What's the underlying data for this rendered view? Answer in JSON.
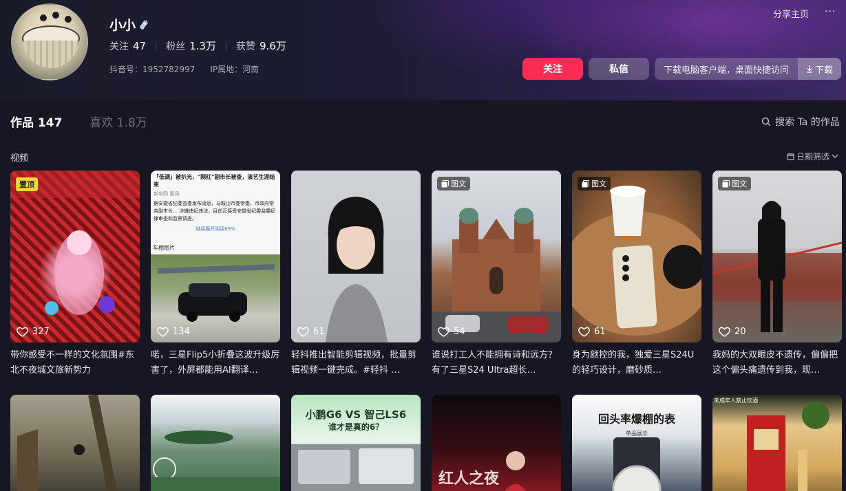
{
  "profile": {
    "name": "小小",
    "following_label": "关注",
    "following_count": "47",
    "followers_label": "粉丝",
    "followers_count": "1.3万",
    "likes_label": "获赞",
    "likes_count": "9.6万",
    "douyin_id": "抖音号：1952782997",
    "ip_location": "IP属地：河南"
  },
  "header": {
    "share_label": "分享主页",
    "more_label": "···",
    "follow_button": "关注",
    "message_button": "私信",
    "download_text": "下载电脑客户端，桌面快捷访问",
    "download_button": "下载"
  },
  "tabs": {
    "works": "作品 147",
    "likes": "喜欢 1.8万",
    "search": "搜索 Ta 的作品"
  },
  "section": {
    "label": "视频",
    "date_filter": "日期筛选"
  },
  "badges": {
    "pinned": "置顶",
    "image_post": "图文"
  },
  "videos_row1": [
    {
      "likes": "327",
      "caption": "带你感受不一样的文化氛围#东北不夜城文旅新势力",
      "pinned": true,
      "type": ""
    },
    {
      "likes": "134",
      "caption": "喏，三星Flip5小折叠这波升级厉害了，外屏都能用AI翻译…",
      "pinned": false,
      "type": ""
    },
    {
      "likes": "61",
      "caption": "轻抖推出智能剪辑视频，批量剪辑视频一键完成。#轻抖 …",
      "pinned": false,
      "type": ""
    },
    {
      "likes": "54",
      "caption": "谁说打工人不能拥有诗和远方？有了三星S24 Ultra超长…",
      "pinned": false,
      "type": "图文"
    },
    {
      "likes": "61",
      "caption": "身为颜控的我，独爱三星S24U的轻巧设计，磨砂质…",
      "pinned": false,
      "type": "图文"
    },
    {
      "likes": "20",
      "caption": "我妈的大双眼皮不遗传，偏偏把这个偏头痛遗传到我，现…",
      "pinned": false,
      "type": "图文"
    }
  ],
  "thumb_text": {
    "news_headline": "「低调」被扒光，\"网红\"副市长被查，演艺生涯结束",
    "news_source": "新华网 要闻",
    "news_body": "据安徽省纪委监委发布消息，马鞍山市委常委、市政府常务副市长… 涉嫌违纪违法，目前正接受安徽省纪委监委纪律审查和监察调查。",
    "news_more": "继续展开阅读69%",
    "news_label": "车棚图片",
    "car_title": "小鹏G6 VS 智己LS6",
    "car_sub": "谁才是真的6？",
    "stage_text": "红人之夜",
    "watch_title": "回头率爆棚的表",
    "watch_sub": "单品展示",
    "tea_top": "未成年人禁止饮酒"
  },
  "colors": {
    "accent": "#fe2c55",
    "pin_badge": "#fcd733",
    "background": "#161722"
  }
}
